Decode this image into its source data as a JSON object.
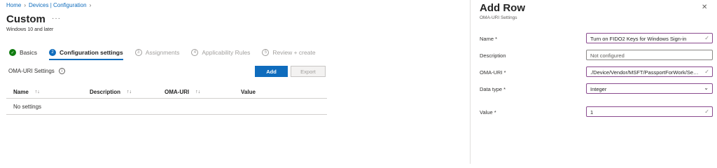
{
  "breadcrumb": [
    "Home",
    "Devices | Configuration"
  ],
  "page": {
    "title": "Custom",
    "more": "···",
    "subtitle": "Windows 10 and later"
  },
  "steps": [
    {
      "num": "✓",
      "label": "Basics",
      "state": "done"
    },
    {
      "num": "2",
      "label": "Configuration settings",
      "state": "active"
    },
    {
      "num": "3",
      "label": "Assignments",
      "state": "pending"
    },
    {
      "num": "4",
      "label": "Applicability Rules",
      "state": "pending"
    },
    {
      "num": "5",
      "label": "Review + create",
      "state": "pending"
    }
  ],
  "oma_settings": {
    "label": "OMA-URI Settings",
    "add_label": "Add",
    "export_label": "Export"
  },
  "table": {
    "columns": [
      "Name",
      "Description",
      "OMA-URI",
      "Value"
    ],
    "empty_text": "No settings"
  },
  "panel": {
    "title": "Add Row",
    "subtitle": "OMA-URI Settings",
    "fields": {
      "name_label": "Name *",
      "name_value": "Turn on FIDO2 Keys for Windows Sign-in",
      "description_label": "Description",
      "description_placeholder": "Not configured",
      "omauri_label": "OMA-URI *",
      "omauri_value": "./Device/Vendor/MSFT/PassportForWork/SecurityKey/UseSecurityKeyForSignin",
      "datatype_label": "Data type *",
      "datatype_value": "Integer",
      "value_label": "Value *",
      "value_value": "1"
    }
  },
  "colors": {
    "accent": "#0f6cbd",
    "success": "#107c10",
    "field_valid_border": "#8a4b8f"
  }
}
